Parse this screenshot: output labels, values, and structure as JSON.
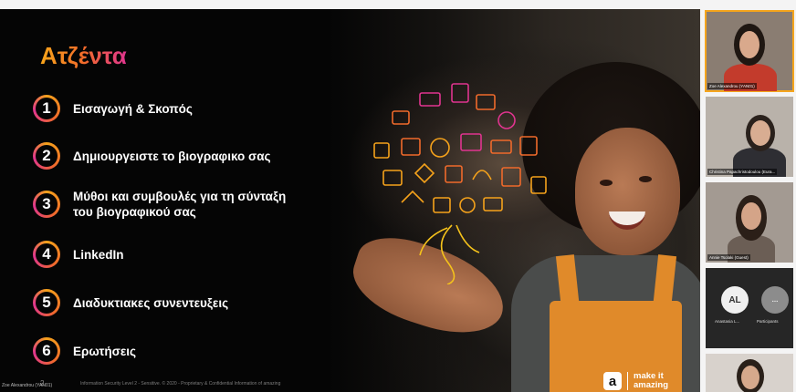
{
  "slide": {
    "title": "Ατζέντα",
    "agenda": [
      {
        "num": "1",
        "text": "Εισαγωγή & Σκοπός"
      },
      {
        "num": "2",
        "text": "Δημιουργειστε το βιογραφικο σας"
      },
      {
        "num": "3",
        "text": "Μύθοι και συμβουλές για τη σύνταξη\nτου βιογραφικού σας"
      },
      {
        "num": "4",
        "text": "LinkedIn"
      },
      {
        "num": "5",
        "text": "Διαδυκτιακες συνεντευξεις"
      },
      {
        "num": "6",
        "text": "Ερωτήσεις"
      }
    ],
    "page_number": "2",
    "footer_text": "Information Security Level 2 - Sensitive. © 2020 - Proprietary & Confidential Information of amazing",
    "brand_mark": "a",
    "brand_text": "make it\namazing",
    "presenter_label": "Zoe Alexandrou (YAN01)"
  },
  "participants": [
    {
      "name": "Zoe Alexandrou (YAN01)",
      "active": true
    },
    {
      "name": "Christina Papachristodoulou (Eura...",
      "active": false
    },
    {
      "name": "Annie Tsolaki (Guest)",
      "active": false
    }
  ],
  "avatar_participants": [
    {
      "initials": "AL",
      "label": "Anastasia L..."
    },
    {
      "initials": "…",
      "label": "Participants"
    }
  ],
  "colors": {
    "accent_orange": "#f5a21b",
    "accent_pink": "#e0348f",
    "active_border": "#f5a51d"
  }
}
